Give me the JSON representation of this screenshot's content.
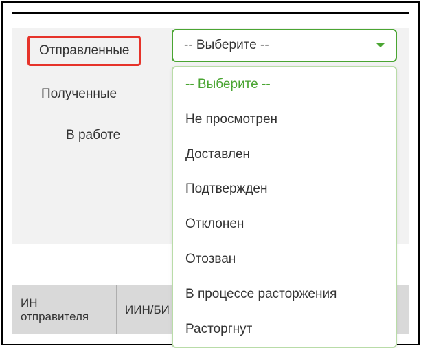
{
  "tabs": {
    "sent": "Отправленные",
    "received": "Полученные",
    "inwork": "В работе"
  },
  "dropdown": {
    "selected": "-- Выберите --",
    "options": {
      "placeholder": "-- Выберите --",
      "not_viewed": "Не просмотрен",
      "delivered": "Доставлен",
      "confirmed": "Подтвержден",
      "rejected": "Отклонен",
      "recalled": "Отозван",
      "in_termination": "В процессе расторжения",
      "terminated": "Расторгнут"
    }
  },
  "table": {
    "headers": {
      "sender_iin": "ИН отправителя",
      "recipient_iin": "ИИН/БИ"
    }
  }
}
